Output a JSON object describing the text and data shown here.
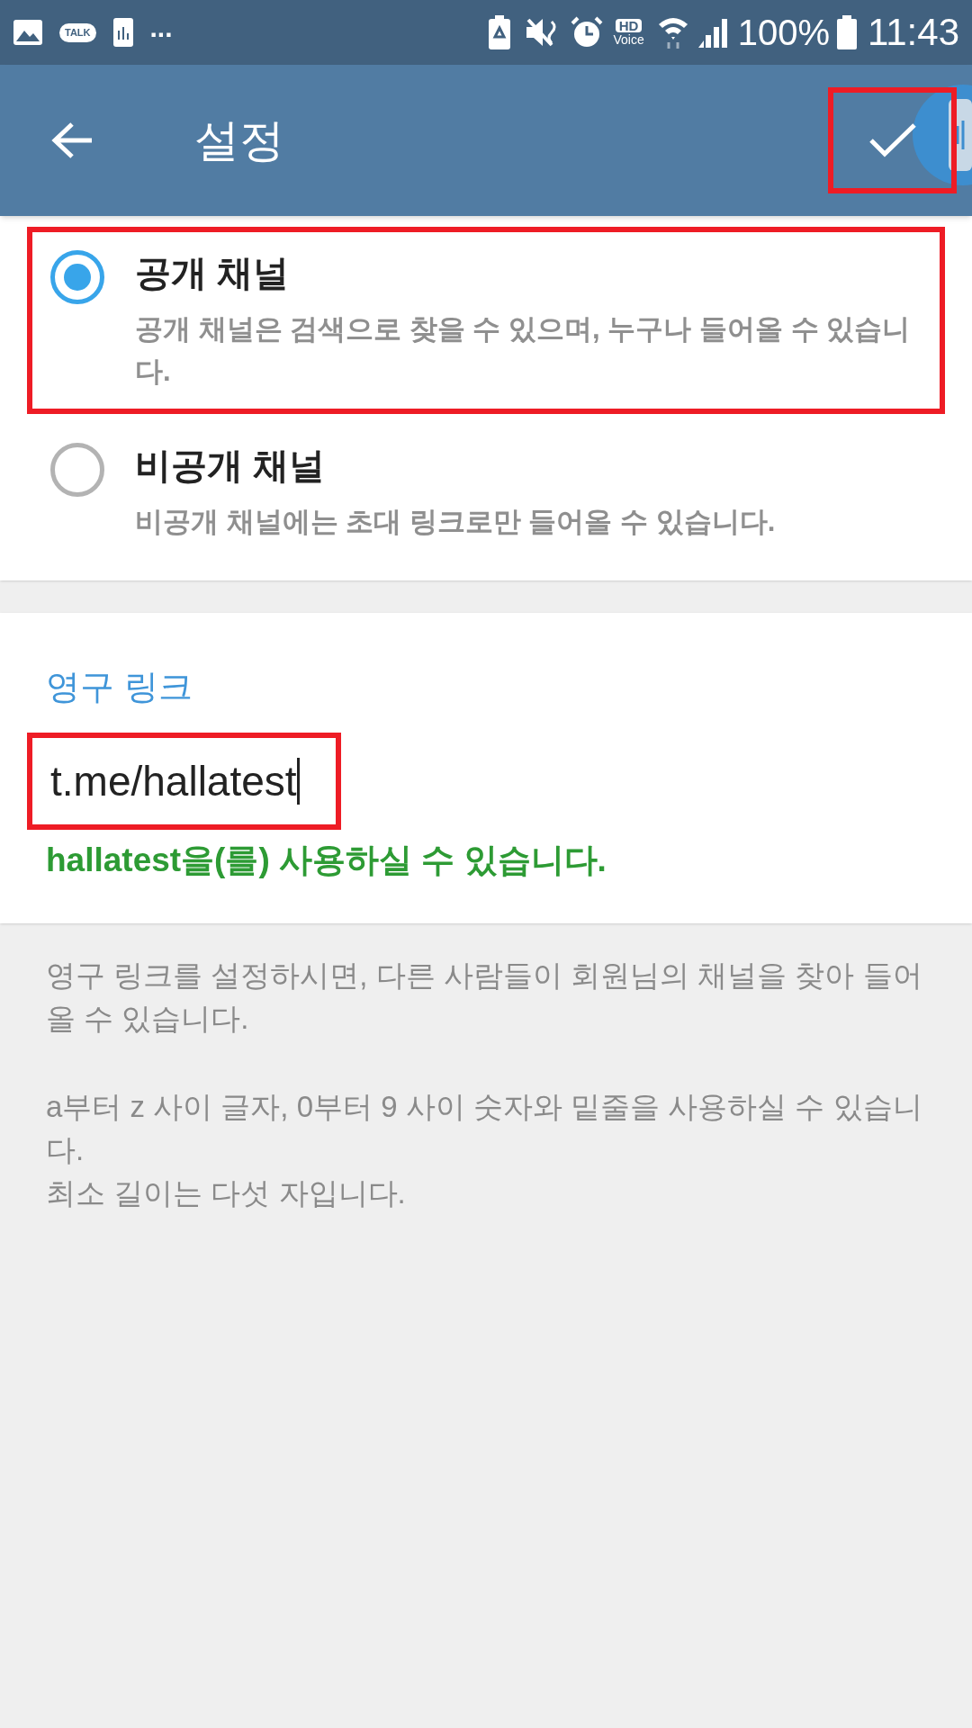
{
  "status_bar": {
    "talk_badge": "TALK",
    "overflow": "...",
    "hd": "HD",
    "voice": "Voice",
    "battery": "100%",
    "time": "11:43"
  },
  "app_bar": {
    "title": "설정",
    "done_highlighted": true
  },
  "channel_types": [
    {
      "title": "공개 채널",
      "description": "공개 채널은 검색으로 찾을 수 있으며, 누구나 들어올 수 있습니다.",
      "selected": true,
      "highlighted": true
    },
    {
      "title": "비공개 채널",
      "description": "비공개 채널에는 초대 링크로만 들어올 수 있습니다.",
      "selected": false,
      "highlighted": false
    }
  ],
  "permanent_link": {
    "label": "영구 링크",
    "value": "t.me/hallatest",
    "highlighted": true,
    "status": "hallatest을(를) 사용하실 수 있습니다."
  },
  "help": [
    "영구 링크를 설정하시면, 다른 사람들이 회원님의 채널을 찾아 들어올 수 있습니다.",
    "a부터 z 사이 글자, 0부터 9 사이 숫자와 밑줄을 사용하실 수 있습니다.\n최소 길이는 다섯 자입니다."
  ]
}
